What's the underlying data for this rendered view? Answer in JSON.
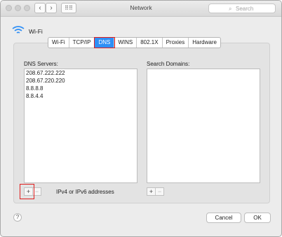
{
  "window": {
    "title": "Network"
  },
  "search": {
    "placeholder": "Search",
    "icon": "search-icon"
  },
  "connection": {
    "name": "Wi-Fi",
    "icon": "wifi-icon"
  },
  "tabs": [
    {
      "label": "Wi-Fi",
      "active": false
    },
    {
      "label": "TCP/IP",
      "active": false
    },
    {
      "label": "DNS",
      "active": true
    },
    {
      "label": "WINS",
      "active": false
    },
    {
      "label": "802.1X",
      "active": false
    },
    {
      "label": "Proxies",
      "active": false
    },
    {
      "label": "Hardware",
      "active": false
    }
  ],
  "dns": {
    "label": "DNS Servers:",
    "servers": [
      "208.67.222.222",
      "208.67.220.220",
      "8.8.8.8",
      "8.8.4.4"
    ],
    "add_label": "+",
    "remove_label": "−",
    "hint": "IPv4 or IPv6 addresses"
  },
  "search_domains": {
    "label": "Search Domains:",
    "add_label": "+",
    "remove_label": "−"
  },
  "footer": {
    "help_label": "?",
    "cancel_label": "Cancel",
    "ok_label": "OK"
  },
  "colors": {
    "accent": "#2f8ff6",
    "highlight": "#e01e1e"
  }
}
